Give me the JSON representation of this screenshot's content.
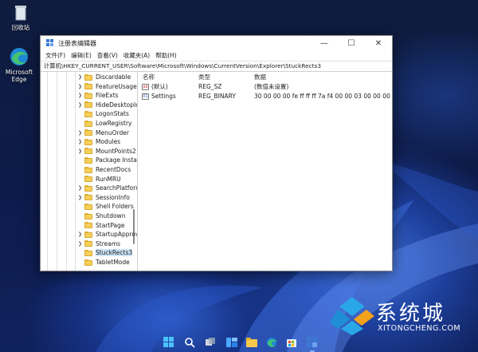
{
  "desktop": {
    "icons": [
      {
        "label": "回收站",
        "icon": "recycle-bin-icon"
      },
      {
        "label": "Microsoft Edge",
        "icon": "edge-icon"
      }
    ]
  },
  "window": {
    "title": "注册表编辑器",
    "menu": [
      "文件(F)",
      "编辑(E)",
      "查看(V)",
      "收藏夹(A)",
      "帮助(H)"
    ],
    "address": "计算机\\HKEY_CURRENT_USER\\Software\\Microsoft\\Windows\\CurrentVersion\\Explorer\\StuckRects3",
    "tree": [
      {
        "label": "Discardable",
        "expandable": true
      },
      {
        "label": "FeatureUsage",
        "expandable": true
      },
      {
        "label": "FileExts",
        "expandable": true
      },
      {
        "label": "HideDesktopIco",
        "expandable": true
      },
      {
        "label": "LogonStats",
        "expandable": false
      },
      {
        "label": "LowRegistry",
        "expandable": false
      },
      {
        "label": "MenuOrder",
        "expandable": true
      },
      {
        "label": "Modules",
        "expandable": true
      },
      {
        "label": "MountPoints2",
        "expandable": true
      },
      {
        "label": "Package Installa",
        "expandable": false
      },
      {
        "label": "RecentDocs",
        "expandable": false
      },
      {
        "label": "RunMRU",
        "expandable": false
      },
      {
        "label": "SearchPlatform",
        "expandable": true
      },
      {
        "label": "SessionInfo",
        "expandable": true
      },
      {
        "label": "Shell Folders",
        "expandable": false
      },
      {
        "label": "Shutdown",
        "expandable": false
      },
      {
        "label": "StartPage",
        "expandable": false
      },
      {
        "label": "StartupApprove",
        "expandable": true
      },
      {
        "label": "Streams",
        "expandable": true
      },
      {
        "label": "StuckRects3",
        "expandable": false,
        "selected": true
      },
      {
        "label": "TabletMode",
        "expandable": false
      }
    ],
    "columns": {
      "name": "名称",
      "type": "类型",
      "data": "数据"
    },
    "values": [
      {
        "name": "(默认)",
        "type": "REG_SZ",
        "data": "(数值未设置)",
        "icon": "string-value-icon"
      },
      {
        "name": "Settings",
        "type": "REG_BINARY",
        "data": "30 00 00 00 fe ff ff ff 7a f4 00 00 03 00 00 00 ...",
        "icon": "binary-value-icon"
      }
    ]
  },
  "watermark": {
    "text": "系统城",
    "url": "XITONGCHENG.COM"
  }
}
